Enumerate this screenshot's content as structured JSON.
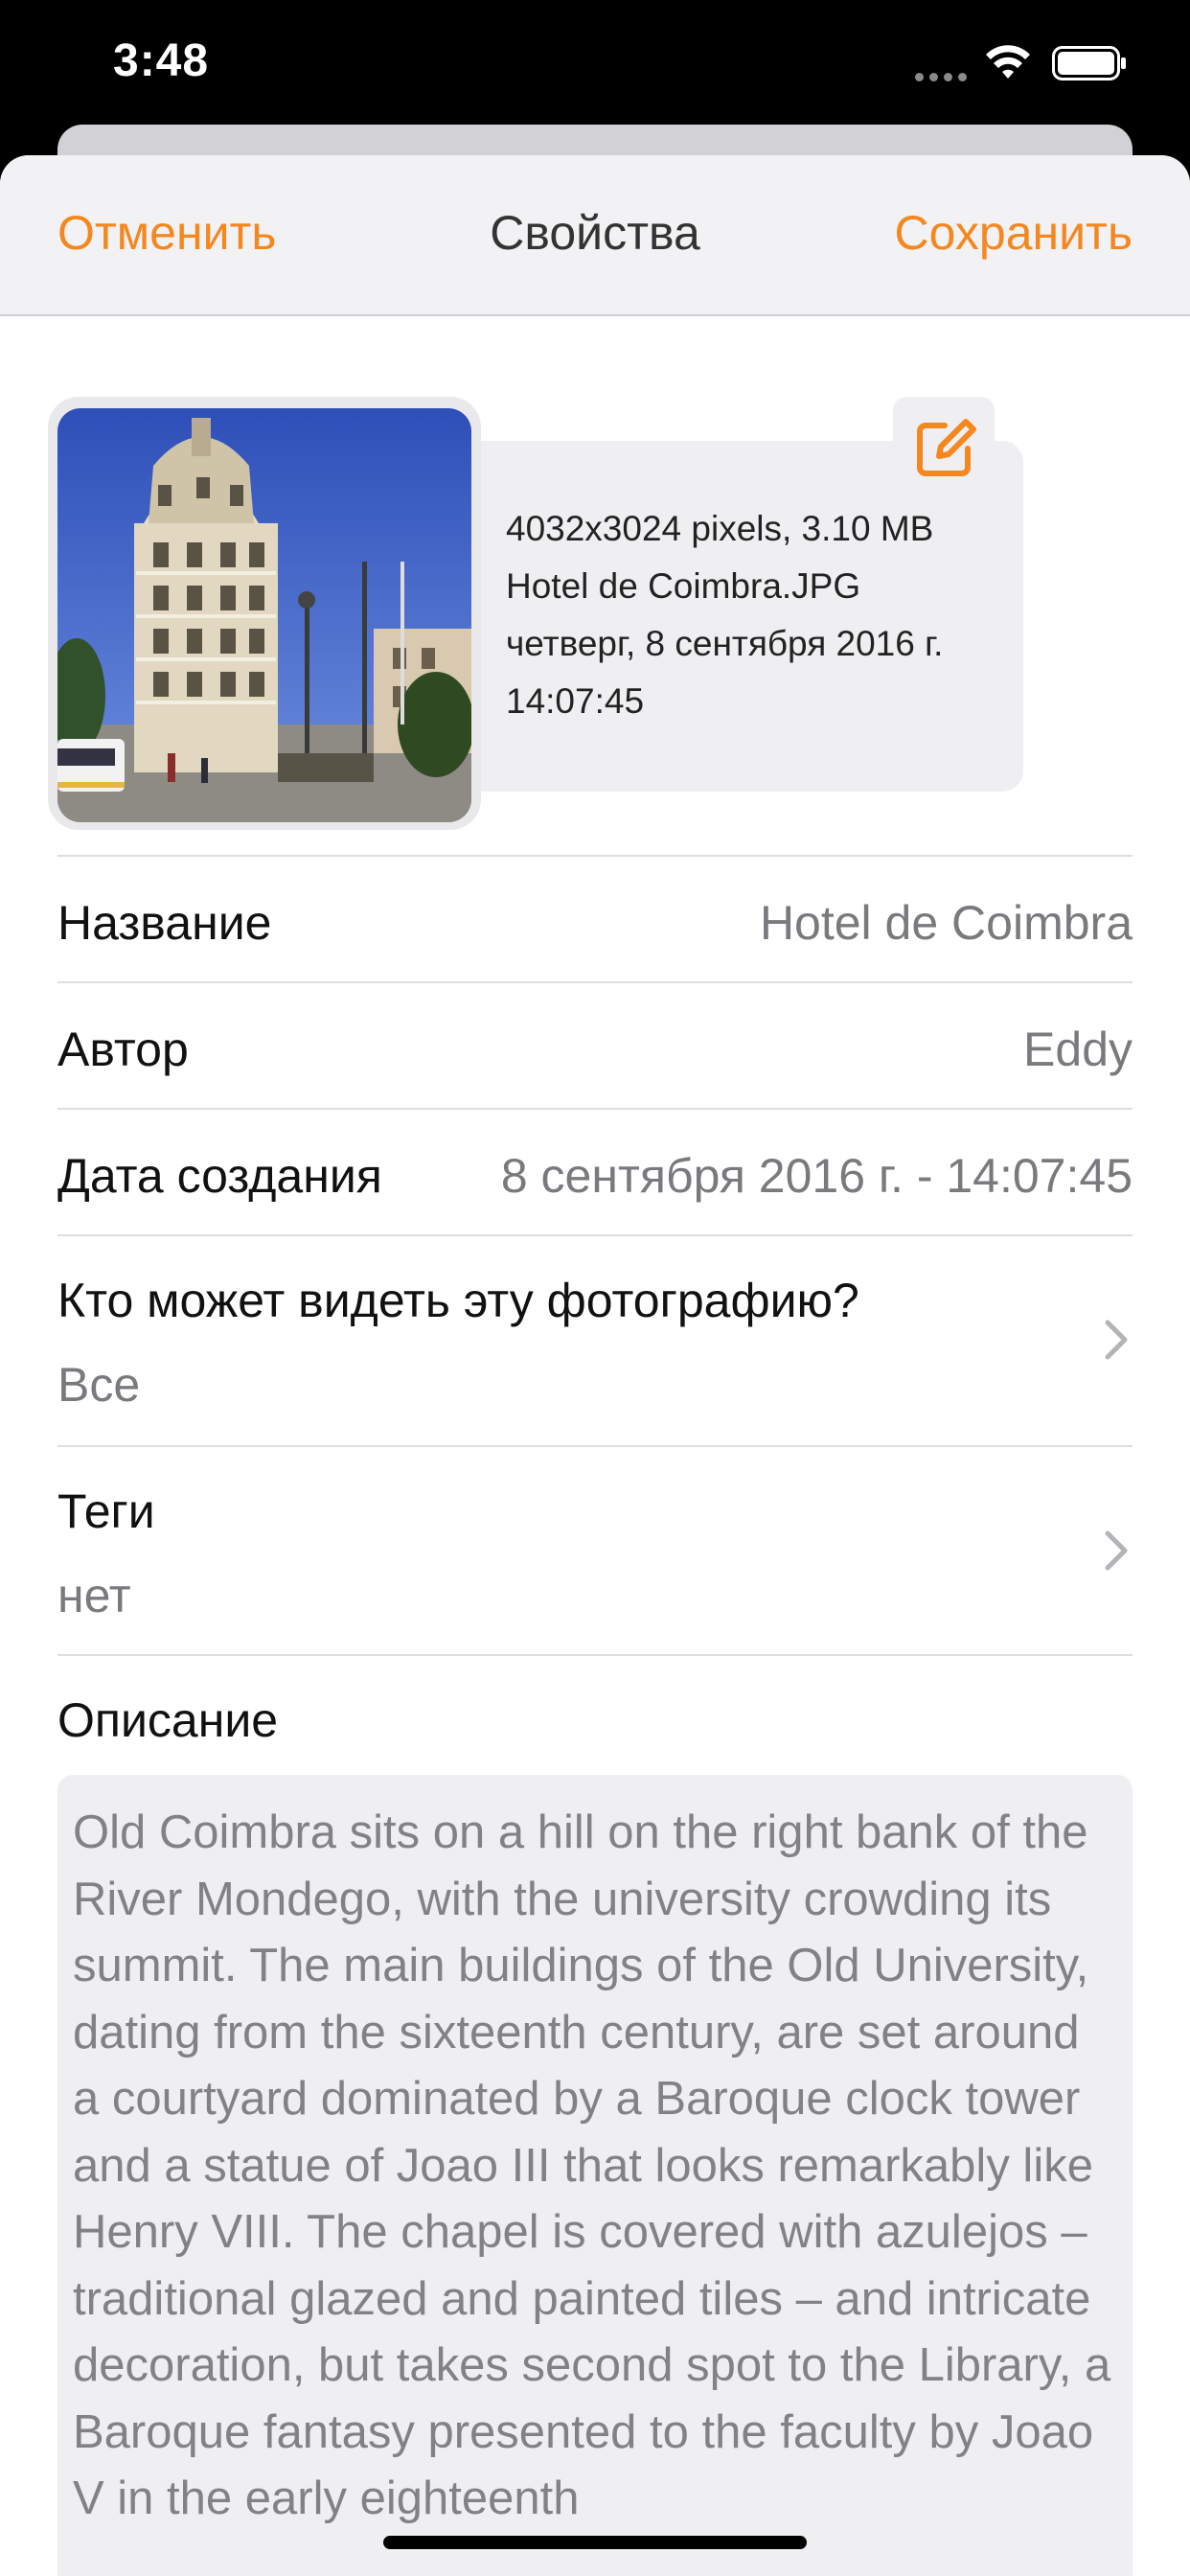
{
  "status_bar": {
    "time": "3:48"
  },
  "nav": {
    "cancel_label": "Отменить",
    "title": "Свойства",
    "save_label": "Сохранить",
    "accent_color": "#f5871f"
  },
  "photo_info": {
    "lines": [
      "4032x3024 pixels, 3.10 MB",
      "Hotel de Coimbra.JPG",
      "четверг, 8 сентября 2016 г.",
      "14:07:45"
    ],
    "edit_icon": "square-pencil-icon",
    "thumbnail_icon": "photo-thumbnail"
  },
  "properties": {
    "title": {
      "label": "Название",
      "value": "Hotel de Coimbra"
    },
    "author": {
      "label": "Автор",
      "value": "Eddy"
    },
    "created": {
      "label": "Дата создания",
      "value": "8 сентября 2016 г. - 14:07:45"
    },
    "visibility": {
      "label": "Кто может видеть эту фотографию?",
      "value": "Все"
    },
    "tags": {
      "label": "Теги",
      "value": "нет"
    }
  },
  "description": {
    "label": "Описание",
    "text": "Old Coimbra sits on a hill on the right bank of the River Mondego, with the university crowding its summit. The main buildings of the Old University, dating from the sixteenth century, are set around a courtyard dominated by a Baroque clock tower and a statue of Joao III that looks remarkably like Henry VIII. The chapel is covered with azulejos – traditional glazed and painted tiles – and intricate decoration, but takes second spot to the Library, a Baroque fantasy presented to the faculty by Joao V in the early eighteenth"
  }
}
